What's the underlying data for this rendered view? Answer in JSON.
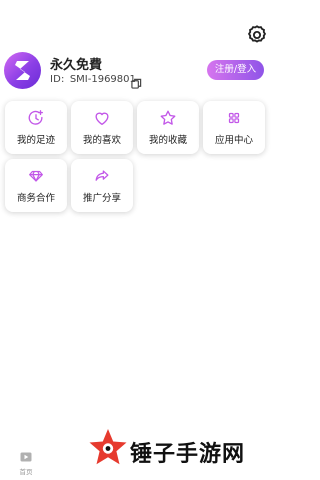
{
  "profile": {
    "name": "永久免費",
    "id_label": "ID:",
    "id_value": "SMI-1969801",
    "login_label": "注册/登入"
  },
  "menu": {
    "tiles": [
      {
        "label": "我的足迹",
        "icon": "clock-icon"
      },
      {
        "label": "我的喜欢",
        "icon": "heart-icon"
      },
      {
        "label": "我的收藏",
        "icon": "star-icon"
      },
      {
        "label": "应用中心",
        "icon": "grid-icon"
      },
      {
        "label": "商务合作",
        "icon": "diamond-icon"
      },
      {
        "label": "推广分享",
        "icon": "share-icon"
      }
    ]
  },
  "bottom_nav": {
    "items": [
      {
        "label": "首页",
        "icon": "play-icon"
      }
    ]
  },
  "watermark": {
    "text": "锤子手游网"
  },
  "colors": {
    "accent": "#c85df0",
    "accent_dark": "#8f54e8",
    "watermark_red": "#e63a2e"
  }
}
